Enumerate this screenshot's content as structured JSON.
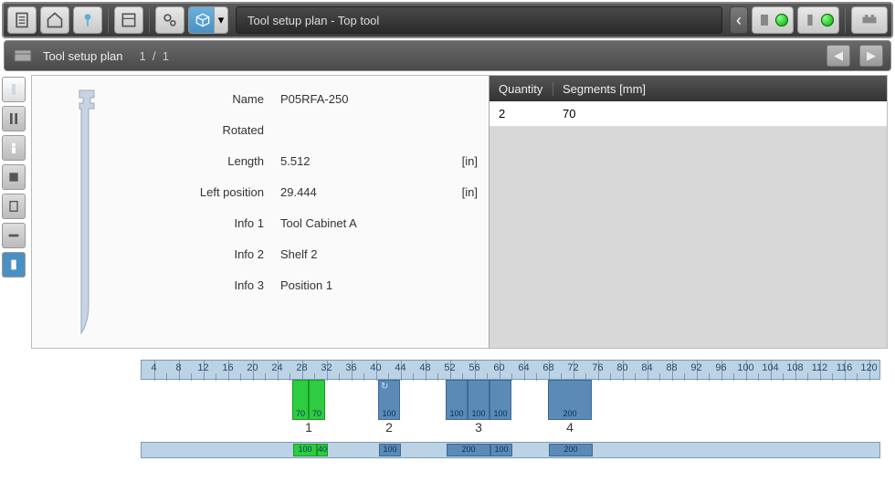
{
  "header": {
    "title": "Tool setup plan - Top tool"
  },
  "subheader": {
    "title": "Tool setup plan",
    "page_current": "1",
    "page_sep": "/",
    "page_total": "1"
  },
  "props": {
    "name_label": "Name",
    "name_value": "P05RFA-250",
    "rotated_label": "Rotated",
    "rotated_value": "",
    "length_label": "Length",
    "length_value": "5.512",
    "length_unit": "[in]",
    "leftpos_label": "Left position",
    "leftpos_value": "29.444",
    "leftpos_unit": "[in]",
    "info1_label": "Info 1",
    "info1_value": "Tool Cabinet A",
    "info2_label": "Info 2",
    "info2_value": "Shelf 2",
    "info3_label": "Info 3",
    "info3_value": "Position 1"
  },
  "segments": {
    "header_qty": "Quantity",
    "header_seg": "Segments [mm]",
    "rows": [
      {
        "qty": "2",
        "seg": "70"
      }
    ]
  },
  "ruler": {
    "labels": [
      "4",
      "8",
      "12",
      "16",
      "20",
      "24",
      "28",
      "32",
      "36",
      "40",
      "44",
      "48",
      "52",
      "56",
      "60",
      "64",
      "68",
      "72",
      "76",
      "80",
      "84",
      "88",
      "92",
      "96",
      "100",
      "104",
      "108",
      "112",
      "116",
      "120"
    ]
  },
  "groups": {
    "g1": "1",
    "g2": "2",
    "g3": "3",
    "g4": "4"
  },
  "blocks": {
    "g1a": "70",
    "g1b": "70",
    "g2": "100",
    "g3a": "100",
    "g3b": "100",
    "g3c": "100",
    "g4": "200"
  },
  "bottom_blocks": {
    "b1a": "100",
    "b1b": "40",
    "b2": "100",
    "b3a": "200",
    "b3b": "100",
    "b4": "200"
  }
}
